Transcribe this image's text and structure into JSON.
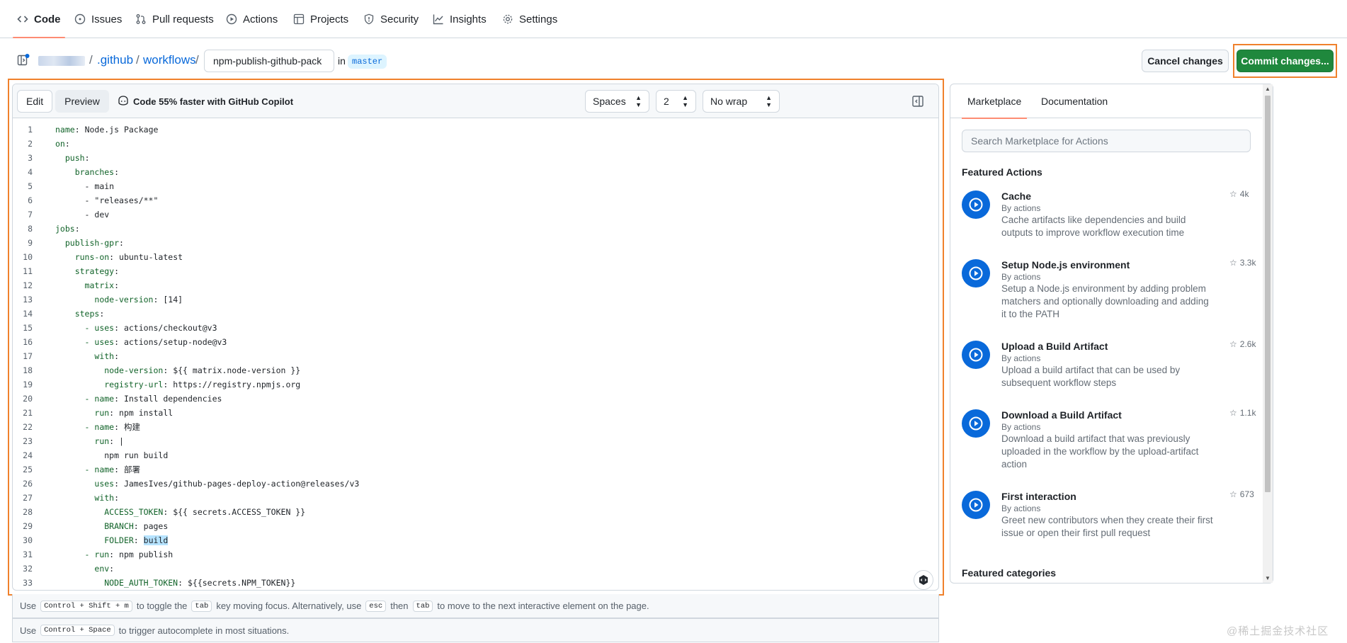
{
  "nav": {
    "tabs": [
      {
        "label": "Code",
        "icon": "code-icon"
      },
      {
        "label": "Issues",
        "icon": "issue-icon"
      },
      {
        "label": "Pull requests",
        "icon": "pull-request-icon"
      },
      {
        "label": "Actions",
        "icon": "play-icon"
      },
      {
        "label": "Projects",
        "icon": "table-icon"
      },
      {
        "label": "Security",
        "icon": "shield-icon"
      },
      {
        "label": "Insights",
        "icon": "graph-icon"
      },
      {
        "label": "Settings",
        "icon": "gear-icon"
      }
    ],
    "active": "Code"
  },
  "path": {
    "crumbs": [
      ".github",
      "workflows"
    ],
    "separator": "/",
    "filename": "npm-publish-github-pack",
    "in_label": "in",
    "branch": "master"
  },
  "actions": {
    "cancel_label": "Cancel changes",
    "commit_label": "Commit changes..."
  },
  "editor": {
    "edit_label": "Edit",
    "preview_label": "Preview",
    "copilot_text": "Code 55% faster with GitHub Copilot",
    "indent_mode": "Spaces",
    "indent_size": "2",
    "wrap_mode": "No wrap",
    "lines": [
      {
        "n": "1",
        "key": "name",
        "rest": " Node.js Package",
        "indent": ""
      },
      {
        "n": "2",
        "key": "on",
        "rest": "",
        "indent": ""
      },
      {
        "n": "3",
        "key": "push",
        "rest": "",
        "indent": "  "
      },
      {
        "n": "4",
        "key": "branches",
        "rest": "",
        "indent": "    "
      },
      {
        "n": "5",
        "key": "",
        "rest": "- main",
        "indent": "      "
      },
      {
        "n": "6",
        "key": "",
        "rest": "- \"releases/**\"",
        "indent": "      "
      },
      {
        "n": "7",
        "key": "",
        "rest": "- dev",
        "indent": "      "
      },
      {
        "n": "8",
        "key": "jobs",
        "rest": "",
        "indent": ""
      },
      {
        "n": "9",
        "key": "publish-gpr",
        "rest": "",
        "indent": "  "
      },
      {
        "n": "10",
        "key": "runs-on",
        "rest": " ubuntu-latest",
        "indent": "    "
      },
      {
        "n": "11",
        "key": "strategy",
        "rest": "",
        "indent": "    "
      },
      {
        "n": "12",
        "key": "matrix",
        "rest": "",
        "indent": "      "
      },
      {
        "n": "13",
        "key": "node-version",
        "rest": " [14]",
        "indent": "        "
      },
      {
        "n": "14",
        "key": "steps",
        "rest": "",
        "indent": "    "
      },
      {
        "n": "15",
        "key": "- uses",
        "rest": " actions/checkout@v3",
        "indent": "      "
      },
      {
        "n": "16",
        "key": "- uses",
        "rest": " actions/setup-node@v3",
        "indent": "      "
      },
      {
        "n": "17",
        "key": "with",
        "rest": "",
        "indent": "        "
      },
      {
        "n": "18",
        "key": "node-version",
        "rest": " ${{ matrix.node-version }}",
        "indent": "          "
      },
      {
        "n": "19",
        "key": "registry-url",
        "rest": " https://registry.npmjs.org",
        "indent": "          "
      },
      {
        "n": "20",
        "key": "- name",
        "rest": " Install dependencies",
        "indent": "      "
      },
      {
        "n": "21",
        "key": "run",
        "rest": " npm install",
        "indent": "        "
      },
      {
        "n": "22",
        "key": "- name",
        "rest": " 构建",
        "indent": "      "
      },
      {
        "n": "23",
        "key": "run",
        "rest": " |",
        "indent": "        "
      },
      {
        "n": "24",
        "key": "",
        "rest": "npm run build",
        "indent": "          "
      },
      {
        "n": "25",
        "key": "- name",
        "rest": " 部署",
        "indent": "      "
      },
      {
        "n": "26",
        "key": "uses",
        "rest": " JamesIves/github-pages-deploy-action@releases/v3",
        "indent": "        "
      },
      {
        "n": "27",
        "key": "with",
        "rest": "",
        "indent": "        "
      },
      {
        "n": "28",
        "key": "ACCESS_TOKEN",
        "rest": " ${{ secrets.ACCESS_TOKEN }}",
        "indent": "          "
      },
      {
        "n": "29",
        "key": "BRANCH",
        "rest": " pages",
        "indent": "          "
      },
      {
        "n": "30",
        "key": "FOLDER",
        "rest": " build",
        "indent": "          ",
        "highlight": "build"
      },
      {
        "n": "31",
        "key": "- run",
        "rest": " npm publish",
        "indent": "      "
      },
      {
        "n": "32",
        "key": "env",
        "rest": "",
        "indent": "        "
      },
      {
        "n": "33",
        "key": "NODE_AUTH_TOKEN",
        "rest": " ${{secrets.NPM_TOKEN}}",
        "indent": "          "
      }
    ]
  },
  "hints": {
    "line1": {
      "use": "Use",
      "keys1": "Control + Shift + m",
      "mid": "to toggle the",
      "key_tab": "tab",
      "mid2": "key moving focus. Alternatively, use",
      "key_esc": "esc",
      "then": "then",
      "key_tab2": "tab",
      "end": "to move to the next interactive element on the page."
    },
    "line2": {
      "use": "Use",
      "keys": "Control + Space",
      "end": "to trigger autocomplete in most situations."
    }
  },
  "sidebar": {
    "tabs": [
      "Marketplace",
      "Documentation"
    ],
    "search_placeholder": "Search Marketplace for Actions",
    "featured_heading": "Featured Actions",
    "categories_heading": "Featured categories",
    "items": [
      {
        "title": "Cache",
        "by": "By actions",
        "desc": "Cache artifacts like dependencies and build outputs to improve workflow execution time",
        "stars": "4k"
      },
      {
        "title": "Setup Node.js environment",
        "by": "By actions",
        "desc": "Setup a Node.js environment by adding problem matchers and optionally downloading and adding it to the PATH",
        "stars": "3.3k"
      },
      {
        "title": "Upload a Build Artifact",
        "by": "By actions",
        "desc": "Upload a build artifact that can be used by subsequent workflow steps",
        "stars": "2.6k"
      },
      {
        "title": "Download a Build Artifact",
        "by": "By actions",
        "desc": "Download a build artifact that was previously uploaded in the workflow by the upload-artifact action",
        "stars": "1.1k"
      },
      {
        "title": "First interaction",
        "by": "By actions",
        "desc": "Greet new contributors when they create their first issue or open their first pull request",
        "stars": "673"
      }
    ]
  },
  "watermark": "@稀土掘金技术社区"
}
